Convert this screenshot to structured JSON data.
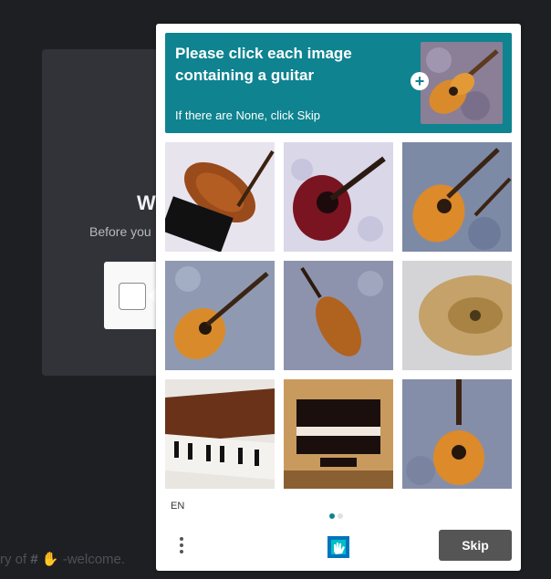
{
  "background": {
    "heading": "W",
    "subtext": "Before you",
    "footer_prefix": "ry of ",
    "footer_channel_hash": "#",
    "footer_channel_name": " -welcome."
  },
  "challenge": {
    "prompt": "Please click each image containing a guitar",
    "hint": "If there are None, click Skip",
    "language": "EN",
    "skip_label": "Skip",
    "accent_color": "#0f8390",
    "tiles": [
      {
        "subject": "violin"
      },
      {
        "subject": "guitar"
      },
      {
        "subject": "guitar"
      },
      {
        "subject": "guitar"
      },
      {
        "subject": "violin"
      },
      {
        "subject": "cymbal"
      },
      {
        "subject": "piano"
      },
      {
        "subject": "piano"
      },
      {
        "subject": "guitar"
      }
    ],
    "page_dots": [
      true,
      false
    ]
  }
}
